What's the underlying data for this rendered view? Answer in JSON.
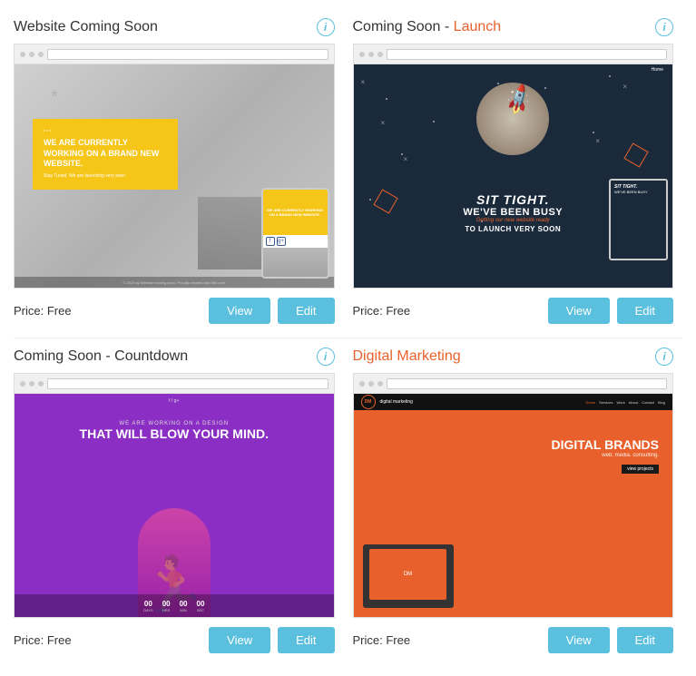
{
  "cards": [
    {
      "id": "website-coming-soon",
      "title": "Website Coming Soon",
      "title_color": "normal",
      "price": "Price: Free",
      "view_label": "View",
      "edit_label": "Edit",
      "preview_description": "Coming soon page with yellow box and tablet"
    },
    {
      "id": "coming-soon-launch",
      "title": "Coming Soon - Launch",
      "title_orange": "Launch",
      "title_prefix": "Coming Soon - ",
      "title_color": "orange",
      "price": "Price: Free",
      "view_label": "View",
      "edit_label": "Edit",
      "preview_description": "Dark space theme with rocket"
    },
    {
      "id": "coming-soon-countdown",
      "title": "Coming Soon - Countdown",
      "title_color": "normal",
      "price": "Price: Free",
      "view_label": "View",
      "edit_label": "Edit",
      "preview_description": "Purple countdown timer theme"
    },
    {
      "id": "digital-marketing",
      "title": "Digital Marketing",
      "title_color": "orange",
      "price": "Price: Free",
      "view_label": "View",
      "edit_label": "Edit",
      "preview_description": "Red and black digital marketing theme"
    }
  ],
  "info_icon_label": "i",
  "preview_1": {
    "yellow_text_small": "* * *",
    "yellow_text_big": "WE ARE CURRENTLY WORKING ON A BRAND NEW WEBSITE.",
    "yellow_text_sub": "Stay Tuned. We are launching very soon"
  },
  "preview_2": {
    "sit_tight": "SIT TIGHT.",
    "weve_been_busy": "WE'VE BEEN BUSY",
    "getting_text": "Getting our new website ready",
    "launch_text": "TO LAUNCH VERY SOON",
    "nav_text": "Home"
  },
  "preview_3": {
    "social_text": "f / g+",
    "working_small": "WE ARE WORKING ON A DESIGN",
    "working_big": "THAT WILL BLOW YOUR MIND.",
    "count_items": [
      {
        "num": "00",
        "label": "DAYS"
      },
      {
        "num": "00",
        "label": "HRS"
      },
      {
        "num": "00",
        "label": "MIN"
      },
      {
        "num": "00",
        "label": "SEC"
      }
    ]
  },
  "preview_4": {
    "logo_text": "DM",
    "brand_text": "digital marketing",
    "menu_items": [
      "Home",
      "Services",
      "Work",
      "About",
      "Contact",
      "Blog"
    ],
    "active_menu": "Home",
    "db_big": "DIGITAL BRANDS",
    "db_small": "web. media. consulting.",
    "view_projects": "view projects"
  }
}
